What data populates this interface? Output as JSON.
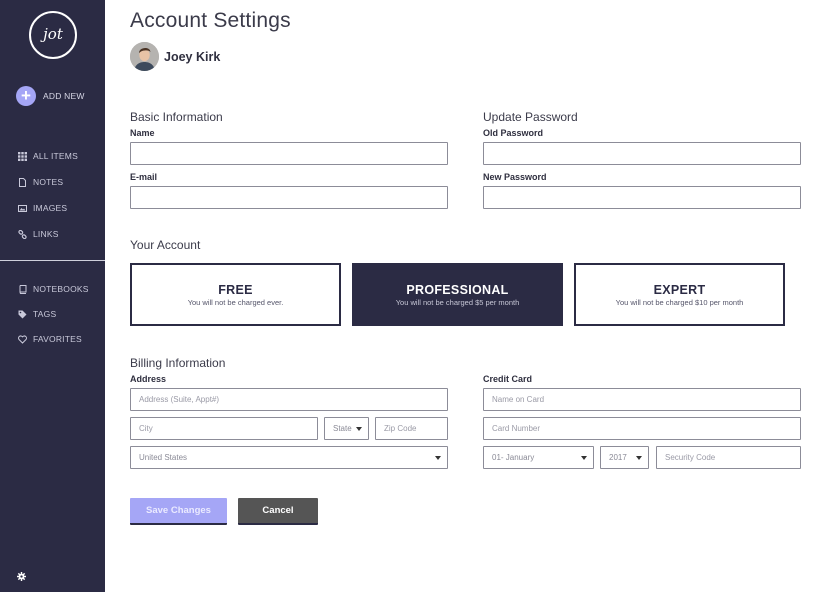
{
  "sidebar": {
    "logo": "jot",
    "add_new": "ADD NEW",
    "items": [
      {
        "label": "ALL ITEMS",
        "icon": "grid-icon"
      },
      {
        "label": "NOTES",
        "icon": "file-icon"
      },
      {
        "label": "IMAGES",
        "icon": "image-icon"
      },
      {
        "label": "LINKS",
        "icon": "link-icon"
      }
    ],
    "items2": [
      {
        "label": "NOTEBOOKS",
        "icon": "book-icon"
      },
      {
        "label": "TAGS",
        "icon": "tag-icon"
      },
      {
        "label": "FAVORITES",
        "icon": "heart-icon"
      }
    ],
    "footer_icon": "gear-icon"
  },
  "page": {
    "title": "Account Settings",
    "user_name": "Joey Kirk"
  },
  "basic_info": {
    "title": "Basic Information",
    "name_label": "Name",
    "name_value": "",
    "email_label": "E-mail",
    "email_value": ""
  },
  "password": {
    "title": "Update Password",
    "old_label": "Old Password",
    "new_label": "New Password"
  },
  "account": {
    "title": "Your Account",
    "plans": [
      {
        "name": "FREE",
        "desc": "You will not be charged ever."
      },
      {
        "name": "PROFESSIONAL",
        "desc": "You will not be charged $5 per month"
      },
      {
        "name": "EXPERT",
        "desc": "You will not be charged $10 per month"
      }
    ],
    "selected_plan": "PROFESSIONAL"
  },
  "billing": {
    "title": "Billing Information",
    "address_label": "Address",
    "address_placeholder": "Address (Suite, Appt#)",
    "city_placeholder": "City",
    "state_value": "State",
    "zip_placeholder": "Zip Code",
    "country_value": "United States",
    "card_label": "Credit Card",
    "card_name_placeholder": "Name on Card",
    "card_number_placeholder": "Card Number",
    "month_value": "01- January",
    "year_value": "2017",
    "security_placeholder": "Security Code"
  },
  "actions": {
    "save": "Save Changes",
    "cancel": "Cancel"
  },
  "colors": {
    "sidebar_bg": "#2b2b44",
    "accent": "#a5a6f6",
    "cancel_bg": "#555555"
  }
}
